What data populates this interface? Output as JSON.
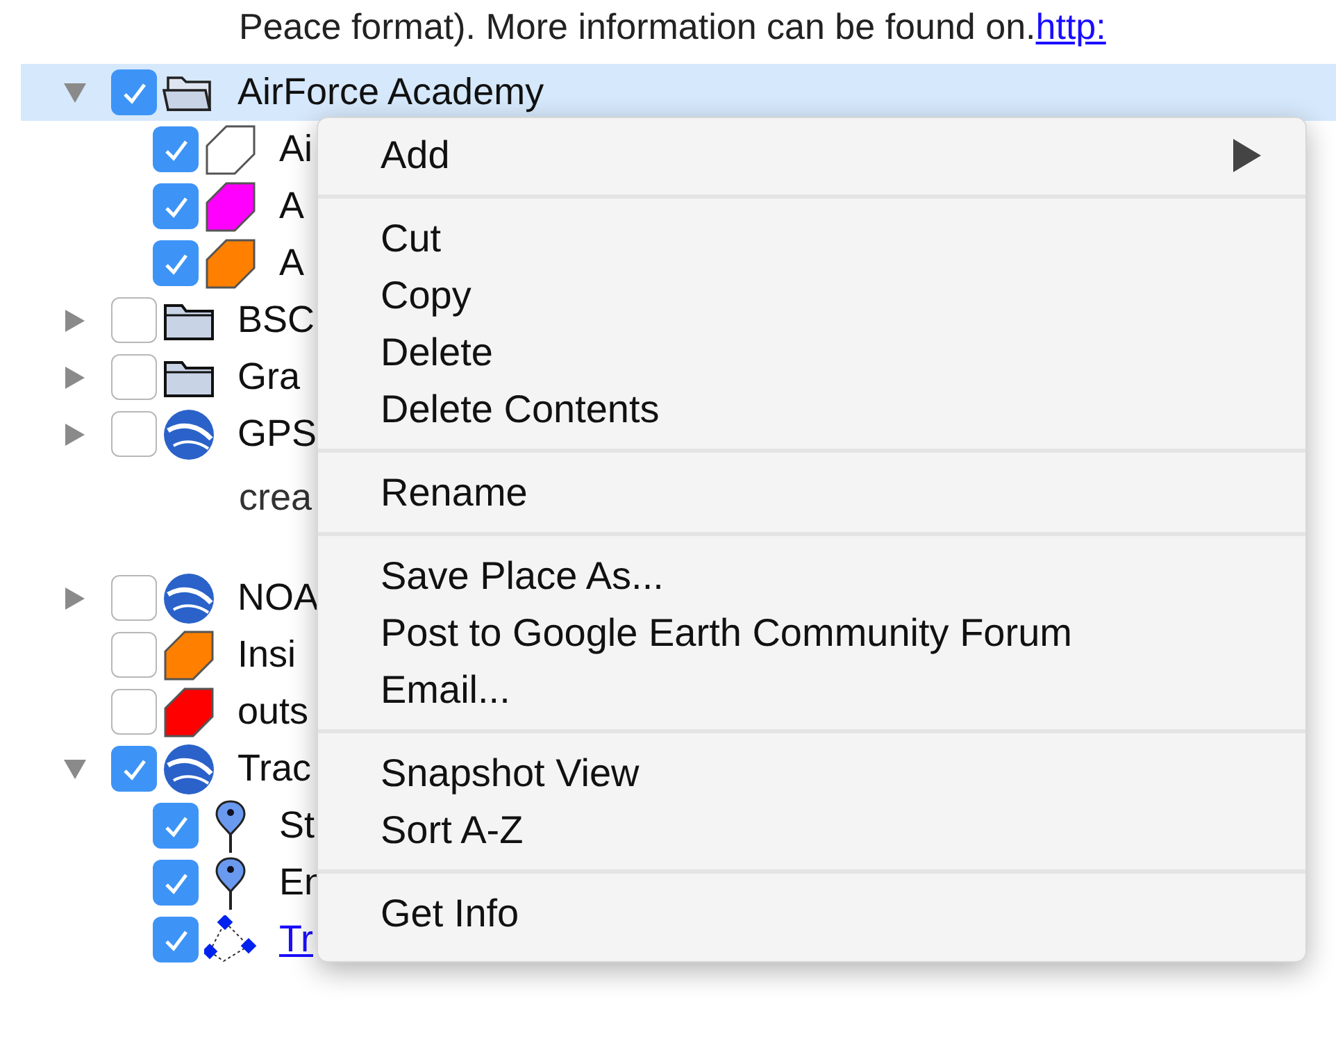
{
  "description_line": {
    "text": "Peace format). More information can be found on.",
    "link": "http:"
  },
  "tree": [
    {
      "text": "AirForce Academy",
      "kind": "folder-open",
      "checked": true,
      "expanded": true,
      "selected": true,
      "children": [
        {
          "text": "Ai",
          "kind": "polygon",
          "color": "#ffffff",
          "checked": true,
          "selected": false
        },
        {
          "text": "A",
          "kind": "polygon",
          "color": "#ff00ff",
          "checked": true,
          "selected": false
        },
        {
          "text": "A",
          "kind": "polygon",
          "color": "#ff8000",
          "checked": true,
          "selected": false
        }
      ]
    },
    {
      "text": "BSC",
      "kind": "folder",
      "checked": false,
      "expanded": false,
      "selected": false
    },
    {
      "text": "Gra",
      "kind": "folder",
      "checked": false,
      "expanded": false,
      "selected": false
    },
    {
      "text": "GPS",
      "kind": "globe",
      "checked": false,
      "expanded": false,
      "selected": false,
      "description": "crea"
    },
    {
      "text": "NOA",
      "kind": "globe",
      "checked": false,
      "expanded": false,
      "selected": false
    },
    {
      "text": "Insi",
      "kind": "polygon",
      "color": "#ff8000",
      "checked": false,
      "selected": false
    },
    {
      "text": "outs",
      "kind": "polygon",
      "color": "#ff0000",
      "checked": false,
      "selected": false
    },
    {
      "text": "Trac",
      "kind": "globe",
      "checked": true,
      "expanded": true,
      "selected": false,
      "children": [
        {
          "text": "St",
          "kind": "pin",
          "checked": true,
          "selected": false
        },
        {
          "text": "En",
          "kind": "pin",
          "checked": true,
          "selected": false
        },
        {
          "text": "Tr",
          "kind": "path",
          "checked": true,
          "selected": false,
          "link": true
        }
      ]
    }
  ],
  "context_menu": [
    [
      {
        "label": "Add",
        "submenu": true
      }
    ],
    [
      {
        "label": "Cut"
      },
      {
        "label": "Copy"
      },
      {
        "label": "Delete"
      },
      {
        "label": "Delete Contents"
      }
    ],
    [
      {
        "label": "Rename"
      }
    ],
    [
      {
        "label": "Save Place As..."
      },
      {
        "label": "Post to Google Earth Community Forum"
      },
      {
        "label": "Email..."
      }
    ],
    [
      {
        "label": "Snapshot View"
      },
      {
        "label": "Sort A-Z"
      }
    ],
    [
      {
        "label": "Get Info"
      }
    ]
  ]
}
